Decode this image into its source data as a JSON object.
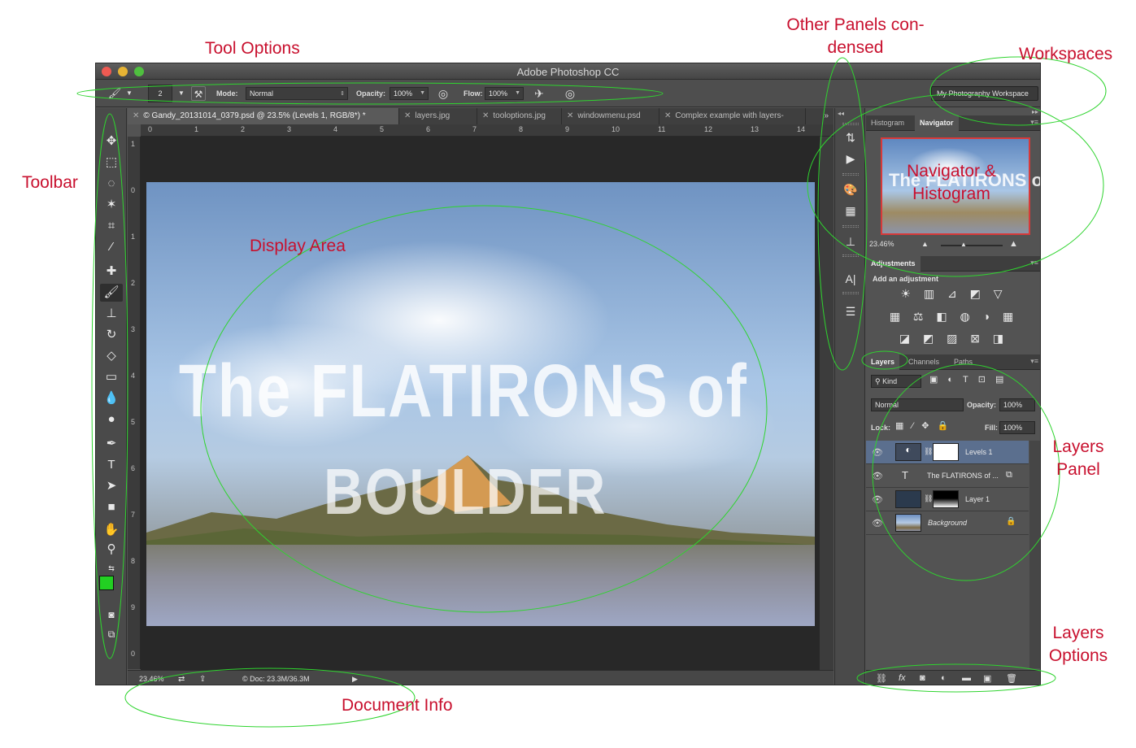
{
  "window": {
    "title": "Adobe Photoshop CC"
  },
  "options_bar": {
    "brush_size": "2",
    "mode_label": "Mode:",
    "mode_value": "Normal",
    "opacity_label": "Opacity:",
    "opacity_value": "100%",
    "flow_label": "Flow:",
    "flow_value": "100%",
    "workspace": "My Photography Workspace"
  },
  "tabs": [
    {
      "label": "© Gandy_20131014_0379.psd @ 23.5% (Levels 1, RGB/8*) *"
    },
    {
      "label": "layers.jpg"
    },
    {
      "label": "tooloptions.jpg"
    },
    {
      "label": "windowmenu.psd"
    },
    {
      "label": "Complex example with layers-"
    }
  ],
  "ruler_top": [
    "0",
    "1",
    "2",
    "3",
    "4",
    "5",
    "6",
    "7",
    "8",
    "9",
    "10",
    "11",
    "12",
    "13",
    "14"
  ],
  "ruler_left": [
    "1",
    "0",
    "1",
    "2",
    "3",
    "4",
    "5",
    "6",
    "7",
    "8",
    "9",
    "0"
  ],
  "canvas": {
    "text_line1": "The FLATIRONS of",
    "text_line2": "BOULDER"
  },
  "status_bar": {
    "zoom": "23.46%",
    "doc_info": "© Doc: 23.3M/36.3M"
  },
  "panels": {
    "histogram_tab": "Histogram",
    "navigator_tab": "Navigator",
    "navigator_zoom": "23.46%",
    "adjustments_tab": "Adjustments",
    "adjustments_title": "Add an adjustment",
    "layers_tabs": [
      "Layers",
      "Channels",
      "Paths"
    ],
    "kind_label": "Kind",
    "blend_mode": "Normal",
    "opacity_label": "Opacity:",
    "opacity_value": "100%",
    "lock_label": "Lock:",
    "fill_label": "Fill:",
    "fill_value": "100%",
    "layers": [
      {
        "name": "Levels 1",
        "selected": true
      },
      {
        "name": "The FLATIRONS of ...",
        "selected": false
      },
      {
        "name": "Layer 1",
        "selected": false
      },
      {
        "name": "Background",
        "selected": false
      }
    ]
  },
  "annotations": {
    "tool_options": "Tool Options",
    "other_panels_line1": "Other Panels con-",
    "other_panels_line2": "densed",
    "workspaces": "Workspaces",
    "toolbar": "Toolbar",
    "display_area": "Display Area",
    "navigator_line1": "Navigator &",
    "navigator_line2": "Histogram",
    "layers_panel_line1": "Layers",
    "layers_panel_line2": "Panel",
    "layers_options_line1": "Layers",
    "layers_options_line2": "Options",
    "document_info": "Document Info",
    "ellipse_color": "#2fd42f",
    "label_color": "#c8102e"
  }
}
